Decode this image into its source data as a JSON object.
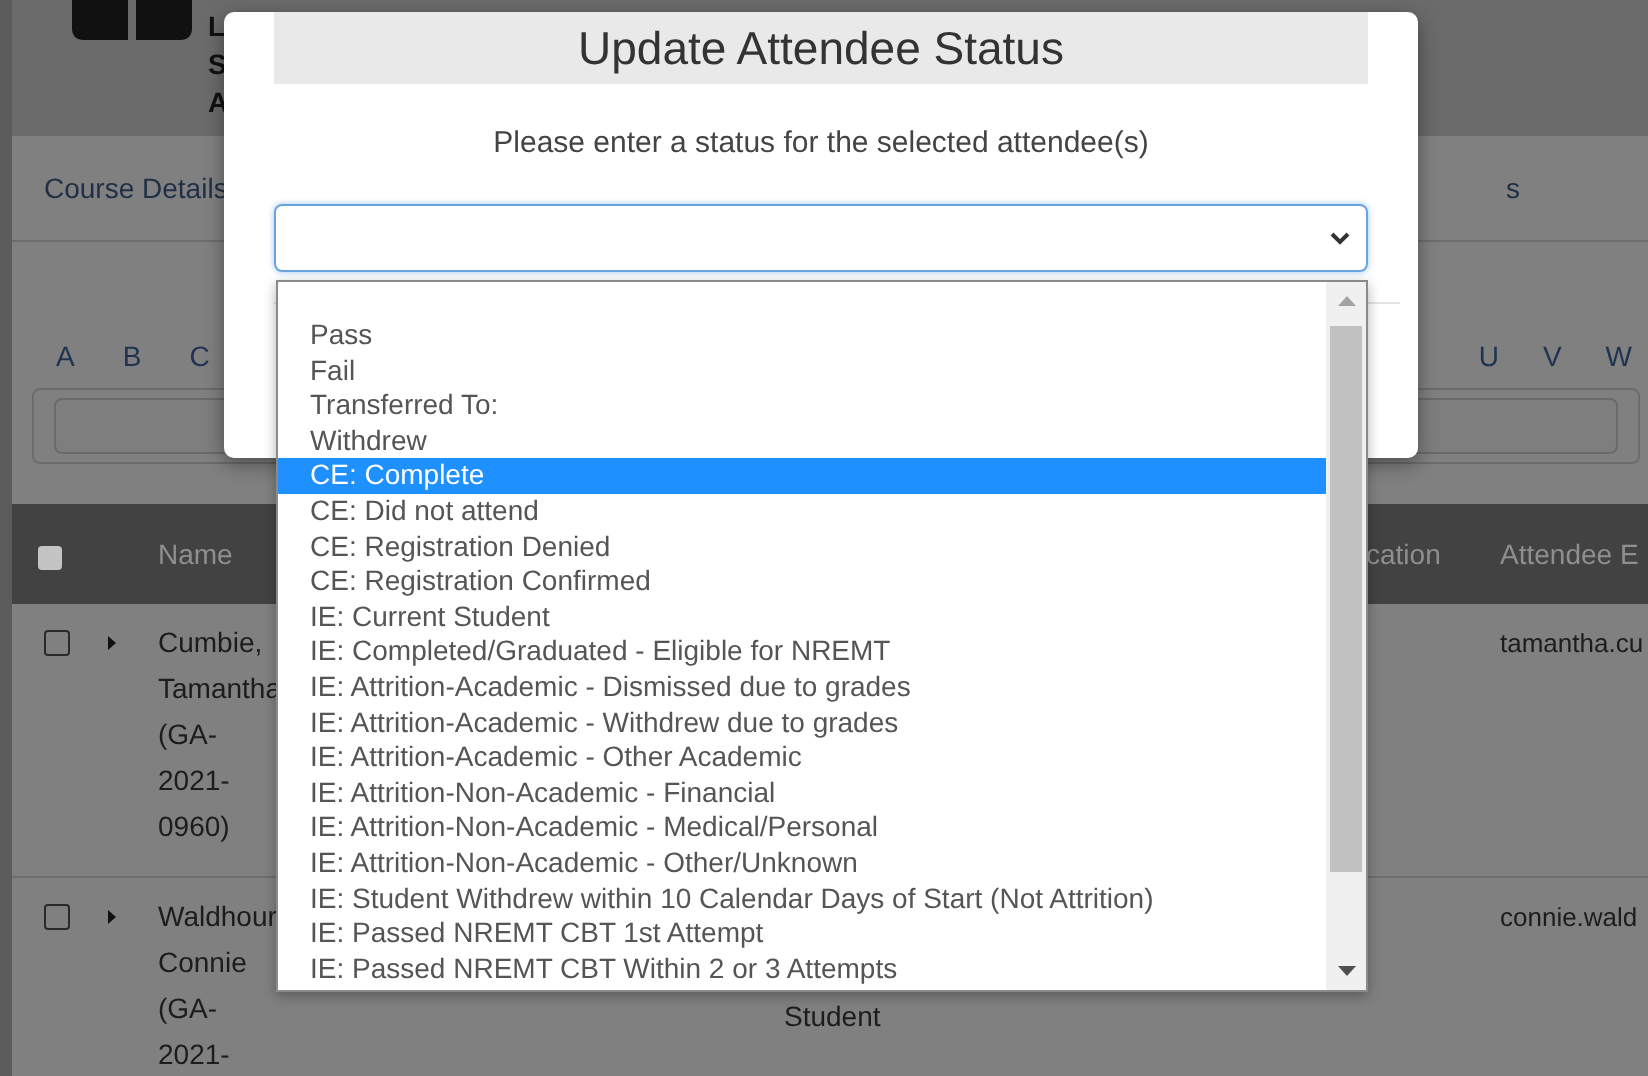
{
  "page": {
    "header_letters": [
      "L",
      "S",
      "A"
    ],
    "tabs": [
      {
        "label": "Course Details"
      },
      {
        "label": "s"
      }
    ],
    "alphabet_left": [
      "A",
      "B",
      "C"
    ],
    "alphabet_right": [
      "U",
      "V",
      "W"
    ],
    "table": {
      "select_all_checked": false,
      "header": {
        "name": "Name",
        "column_4": "cation",
        "column_5": "Attendee E"
      },
      "rows": [
        {
          "checked": false,
          "name": "Cumbie, Tamantha (GA-2021-0960)",
          "email": "tamantha.cu"
        },
        {
          "checked": false,
          "name": "Waldhour Connie (GA-2021-",
          "column_3": "Student",
          "email": "connie.wald"
        }
      ]
    }
  },
  "modal": {
    "title": "Update Attendee Status",
    "prompt": "Please enter a status for the selected attendee(s)",
    "options": [
      {
        "label": "Pass",
        "selected": false
      },
      {
        "label": "Fail",
        "selected": false
      },
      {
        "label": "Transferred To:",
        "selected": false
      },
      {
        "label": "Withdrew",
        "selected": false
      },
      {
        "label": "CE: Complete",
        "selected": true
      },
      {
        "label": "CE: Did not attend",
        "selected": false
      },
      {
        "label": "CE: Registration Denied",
        "selected": false
      },
      {
        "label": "CE: Registration Confirmed",
        "selected": false
      },
      {
        "label": "IE: Current Student",
        "selected": false
      },
      {
        "label": "IE: Completed/Graduated - Eligible for NREMT",
        "selected": false
      },
      {
        "label": "IE: Attrition-Academic - Dismissed due to grades",
        "selected": false
      },
      {
        "label": "IE: Attrition-Academic - Withdrew due to grades",
        "selected": false
      },
      {
        "label": "IE: Attrition-Academic - Other Academic",
        "selected": false
      },
      {
        "label": "IE: Attrition-Non-Academic - Financial",
        "selected": false
      },
      {
        "label": "IE: Attrition-Non-Academic - Medical/Personal",
        "selected": false
      },
      {
        "label": "IE: Attrition-Non-Academic - Other/Unknown",
        "selected": false
      },
      {
        "label": "IE: Student Withdrew within 10 Calendar Days of Start (Not Attrition)",
        "selected": false
      },
      {
        "label": "IE: Passed NREMT CBT 1st Attempt",
        "selected": false
      },
      {
        "label": "IE: Passed NREMT CBT Within 2 or 3 Attempts",
        "selected": false
      }
    ]
  }
}
